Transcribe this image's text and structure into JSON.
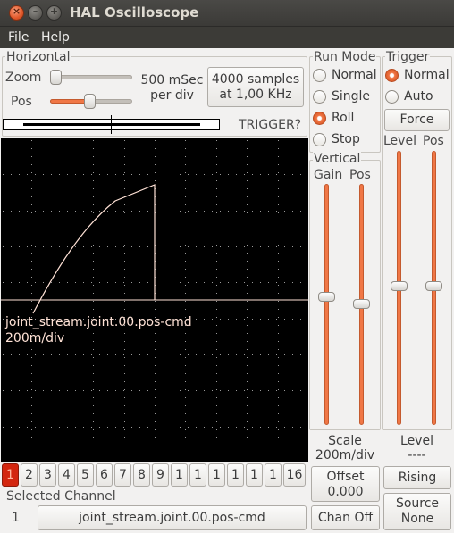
{
  "window": {
    "title": "HAL Oscilloscope"
  },
  "menu": {
    "file": "File",
    "help": "Help"
  },
  "horizontal": {
    "label": "Horizontal",
    "zoom_label": "Zoom",
    "pos_label": "Pos",
    "zoom_level": 0.0,
    "pos_level": 0.48,
    "rate_line1": "500 mSec",
    "rate_line2": "per div",
    "samples_line1": "4000 samples",
    "samples_line2": "at 1,00 KHz",
    "trigger_status": "TRIGGER?"
  },
  "run_mode": {
    "label": "Run Mode",
    "options": [
      "Normal",
      "Single",
      "Roll",
      "Stop"
    ],
    "selected": "Roll"
  },
  "trigger": {
    "label": "Trigger",
    "options": [
      "Normal",
      "Auto"
    ],
    "selected": "Normal",
    "force_label": "Force",
    "level_label": "Level",
    "pos_label": "Pos",
    "level_value_label": "Level",
    "level_value": "----",
    "rising_label": "Rising",
    "source_line1": "Source",
    "source_line2": "None"
  },
  "vertical": {
    "label": "Vertical",
    "gain_label": "Gain",
    "pos_label": "Pos",
    "scale_label": "Scale",
    "scale_value": "200m/div",
    "offset_line1": "Offset",
    "offset_line2": "0.000",
    "chan_off_label": "Chan Off"
  },
  "scope": {
    "channel_name": "joint_stream.joint.00.pos-cmd",
    "channel_scale": "200m/div"
  },
  "channels": [
    "1",
    "2",
    "3",
    "4",
    "5",
    "6",
    "7",
    "8",
    "9",
    "1",
    "1",
    "1",
    "1",
    "1",
    "1",
    "16"
  ],
  "selected_channel": {
    "label": "Selected Channel",
    "number": "1",
    "name": "joint_stream.joint.00.pos-cmd"
  },
  "colors": {
    "accent": "#f07746",
    "trace": "#ffe2d6",
    "active_channel": "#d3260f"
  }
}
